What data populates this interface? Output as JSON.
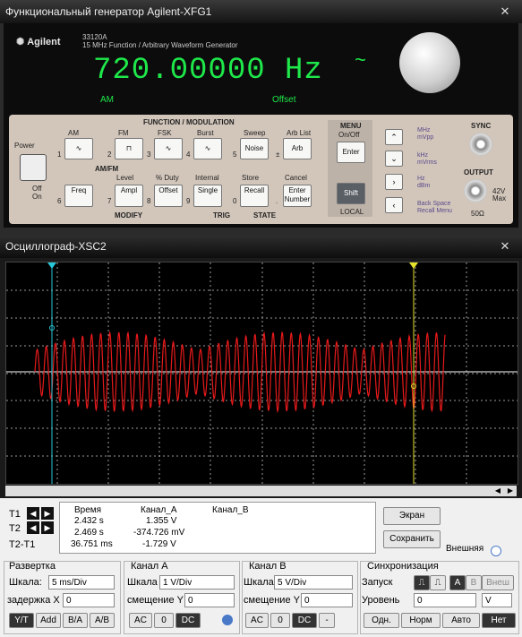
{
  "generator": {
    "title": "Функциональный генератор Agilent-XFG1",
    "brand": "Agilent",
    "model_line1": "33120A",
    "model_line2": "15 MHz Function / Arbitrary Waveform Generator",
    "display_value": "720.00000 Hz",
    "display_tilde": "~",
    "ann_am": "AM",
    "ann_offset": "Offset",
    "header_function": "FUNCTION / MODULATION",
    "header_amfm": "AM/FM",
    "header_modify": "MODIFY",
    "header_trig": "TRIG",
    "header_state": "STATE",
    "power_label": "Power",
    "off_label": "Off",
    "on_label": "On",
    "top_labels": [
      "AM",
      "FM",
      "FSK",
      "Burst",
      "Sweep",
      "Arb List"
    ],
    "top_buttons": [
      "∿",
      "⊓",
      "∿",
      "∿",
      "Noise",
      "Arb"
    ],
    "top_numbers": [
      "1",
      "2",
      "3",
      "4",
      "5",
      "±"
    ],
    "bottom_labels": [
      "Level",
      "% Duty",
      "Internal",
      "Store",
      "Cancel"
    ],
    "bottom_buttons": [
      "Freq",
      "Ampl",
      "Offset",
      "Single",
      "Recall",
      "Enter Number"
    ],
    "bottom_numbers": [
      "6",
      "7",
      "8",
      "9",
      "0",
      "."
    ],
    "menu_title": "MENU",
    "menu_sub": "On/Off",
    "enter_label": "Enter",
    "shift_label": "Shift",
    "local_label": "LOCAL",
    "arrows": [
      "⌃",
      "⌄",
      "›",
      "‹"
    ],
    "units": [
      "MHz",
      "mVpp",
      "kHz",
      "mVrms",
      "Hz",
      "dBm",
      "Back Space",
      "Recall Menu"
    ],
    "sync_label": "SYNC",
    "output_label": "OUTPUT",
    "output_spec": "42V Max",
    "ohm_label": "50Ω"
  },
  "scope": {
    "title": "Осциллограф-XSC2",
    "t1_label": "T1",
    "t2_label": "T2",
    "t2t1_label": "T2-T1",
    "col_time": "Время",
    "col_a": "Канал_А",
    "col_b": "Канал_В",
    "t1_time": "2.432 s",
    "t1_a": "1.355 V",
    "t2_time": "2.469 s",
    "t2_a": "-374.726 mV",
    "d_time": "36.751 ms",
    "d_a": "-1.729 V",
    "btn_screen": "Экран",
    "btn_save": "Сохранить",
    "external": "Внешняя",
    "sweep": {
      "title": "Развертка",
      "scale_label": "Шкала:",
      "scale": "5 ms/Div",
      "delay_label": "задержка X",
      "delay": "0",
      "buttons": [
        "Y/T",
        "Add",
        "B/A",
        "A/B"
      ]
    },
    "chA": {
      "title": "Канал А",
      "scale_label": "Шкала",
      "scale": "1 V/Div",
      "offset_label": "смещение Y",
      "offset": "0",
      "buttons": [
        "AC",
        "0",
        "DC"
      ]
    },
    "chB": {
      "title": "Канал В",
      "scale_label": "Шкала",
      "scale": "5 V/Div",
      "offset_label": "смещение Y",
      "offset": "0",
      "buttons": [
        "AC",
        "0",
        "DC",
        "-"
      ]
    },
    "sync": {
      "title": "Синхронизация",
      "trigger_label": "Запуск",
      "level_label": "Уровень",
      "level": "0",
      "level_unit": "V",
      "src": [
        "A",
        "B",
        "Внеш"
      ],
      "modes": [
        "Одн.",
        "Норм",
        "Авто",
        "Нет"
      ]
    }
  },
  "colors": {
    "lcd": "#1ee84a",
    "trace": "#e8191a",
    "cursor1": "#27c7d8",
    "cursor2": "#e6e22c"
  }
}
